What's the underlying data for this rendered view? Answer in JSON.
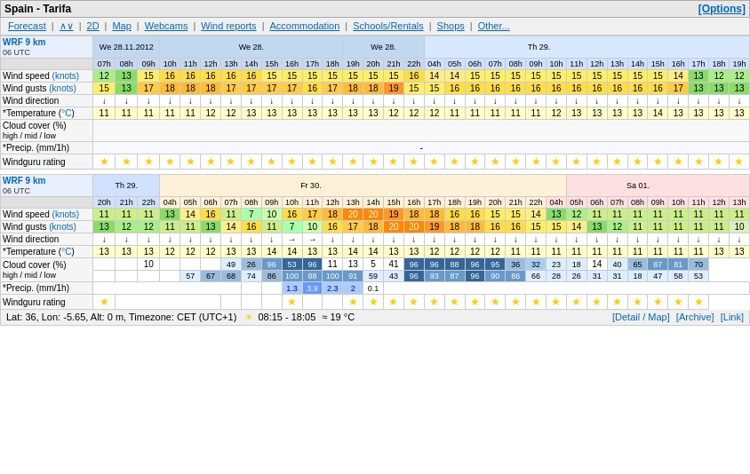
{
  "title": "Spain - Tarifa",
  "options_label": "[Options]",
  "nav": {
    "forecast": "Forecast",
    "wv": "∧∨",
    "2d": "2D",
    "map": "Map",
    "webcams": "Webcams",
    "wind_reports": "Wind reports",
    "accommodation": "Accommodation",
    "schools_rentals": "Schools/Rentals",
    "shops": "Shops",
    "other": "Other..."
  },
  "footer": {
    "left": "Lat: 36, Lon: -5.65, Alt: 0 m, Timezone: CET (UTC+1)",
    "sun": "☀",
    "sun_times": "08:15 - 18:05",
    "temp": "≈ 19 °C",
    "detail": "[Detail / Map]",
    "archive": "[Archive]",
    "link": "[Link]"
  },
  "section1": {
    "model": "WRF 9 km",
    "utc": "06 UTC",
    "dates": [
      "We 28.11.2012",
      "We 28.",
      "We 28.",
      "We 28.",
      "We 28.",
      "We 28.",
      "We 28.",
      "We 28.",
      "We 28.",
      "We 28.",
      "We 28.",
      "We 28.",
      "We 28.",
      "Th 29.",
      "Th 29.",
      "Th 29.",
      "Th 29.",
      "Th 29.",
      "Th 29.",
      "Th 29.",
      "Th 29.",
      "Th 29.",
      "Th 29.",
      "Th 29.",
      "Th 29.",
      "Th 29.",
      "Th 29.",
      "Th 29.",
      "Th 29.",
      "Th 29.",
      "Th 29.",
      "Th 29.",
      "Th 29.",
      "Th 29."
    ],
    "times": [
      "07h",
      "08h",
      "09h",
      "10h",
      "11h",
      "12h",
      "13h",
      "14h",
      "15h",
      "16h",
      "17h",
      "18h",
      "19h",
      "20h",
      "21h",
      "22h",
      "04h",
      "05h",
      "06h",
      "07h",
      "08h",
      "09h",
      "10h",
      "11h",
      "12h",
      "13h",
      "14h",
      "15h",
      "16h",
      "17h",
      "18h",
      "19h"
    ],
    "wind_speed": [
      12,
      13,
      15,
      16,
      16,
      16,
      16,
      16,
      15,
      15,
      15,
      15,
      15,
      15,
      15,
      16,
      14,
      14,
      15,
      15,
      15,
      15,
      15,
      15,
      15,
      15,
      15,
      15,
      14,
      13,
      12,
      12
    ],
    "wind_gusts": [
      15,
      13,
      17,
      18,
      18,
      18,
      17,
      17,
      17,
      17,
      16,
      17,
      18,
      18,
      19,
      15,
      15,
      16,
      16,
      16,
      16,
      16,
      16,
      16,
      16,
      16,
      16,
      16,
      17,
      13,
      13,
      13
    ],
    "temps": [
      11,
      11,
      11,
      11,
      11,
      12,
      12,
      13,
      13,
      13,
      13,
      13,
      13,
      13,
      12,
      12,
      12,
      11,
      11,
      11,
      11,
      11,
      12,
      13,
      13,
      13,
      13,
      14,
      13,
      13,
      13,
      13
    ],
    "ratings_positions": [
      0,
      1,
      2,
      3,
      4,
      5,
      6,
      7,
      8,
      9,
      10,
      11,
      12,
      13,
      14,
      15,
      16,
      17,
      18,
      19,
      20,
      21,
      22,
      23,
      24,
      25,
      26,
      27,
      28,
      29,
      30,
      31
    ]
  },
  "section2": {
    "model": "WRF 9 km",
    "utc": "06 UTC",
    "dates": [
      "Th 29.",
      "Th 29.",
      "Th 29.",
      "Fr 30.",
      "Fr 30.",
      "Fr 30.",
      "Fr 30.",
      "Fr 30.",
      "Fr 30.",
      "Fr 30.",
      "Fr 30.",
      "Fr 30.",
      "Fr 30.",
      "Fr 30.",
      "Fr 30.",
      "Fr 30.",
      "Fr 30.",
      "Fr 30.",
      "Fr 30.",
      "Fr 30.",
      "Fr 30.",
      "Fr 30.",
      "Fr 30.",
      "Fr 30.",
      "Fr 30.",
      "Sa 01.",
      "Sa 01.",
      "Sa 01.",
      "Sa 01.",
      "Sa 01.",
      "Sa 01.",
      "Sa 01.",
      "Sa 01.",
      "Sa 01."
    ],
    "times": [
      "20h",
      "21h",
      "22h",
      "04h",
      "05h",
      "06h",
      "07h",
      "08h",
      "09h",
      "10h",
      "11h",
      "12h",
      "13h",
      "14h",
      "15h",
      "16h",
      "17h",
      "18h",
      "19h",
      "20h",
      "21h",
      "22h",
      "04h",
      "05h",
      "06h",
      "07h",
      "08h",
      "09h",
      "10h",
      "11h",
      "12h",
      "13h"
    ],
    "wind_speed": [
      11,
      11,
      11,
      13,
      14,
      16,
      11,
      7,
      10,
      16,
      17,
      18,
      20,
      20,
      19,
      18,
      18,
      16,
      16,
      15,
      15,
      14,
      13,
      12,
      11,
      11,
      11,
      11,
      11,
      11,
      11,
      11
    ],
    "wind_gusts": [
      13,
      12,
      12,
      11,
      11,
      13,
      14,
      16,
      11,
      7,
      10,
      16,
      17,
      18,
      20,
      20,
      19,
      18,
      18,
      16,
      16,
      15,
      15,
      14,
      13,
      12,
      11,
      11,
      11,
      11,
      11,
      10
    ],
    "temps": [
      13,
      13,
      13,
      12,
      12,
      12,
      13,
      13,
      14,
      14,
      13,
      13,
      14,
      14,
      13,
      13,
      12,
      12,
      12,
      12,
      11,
      11,
      11,
      11,
      11,
      11,
      11,
      11,
      11,
      11,
      11,
      13,
      13,
      13
    ]
  },
  "stars": "★"
}
